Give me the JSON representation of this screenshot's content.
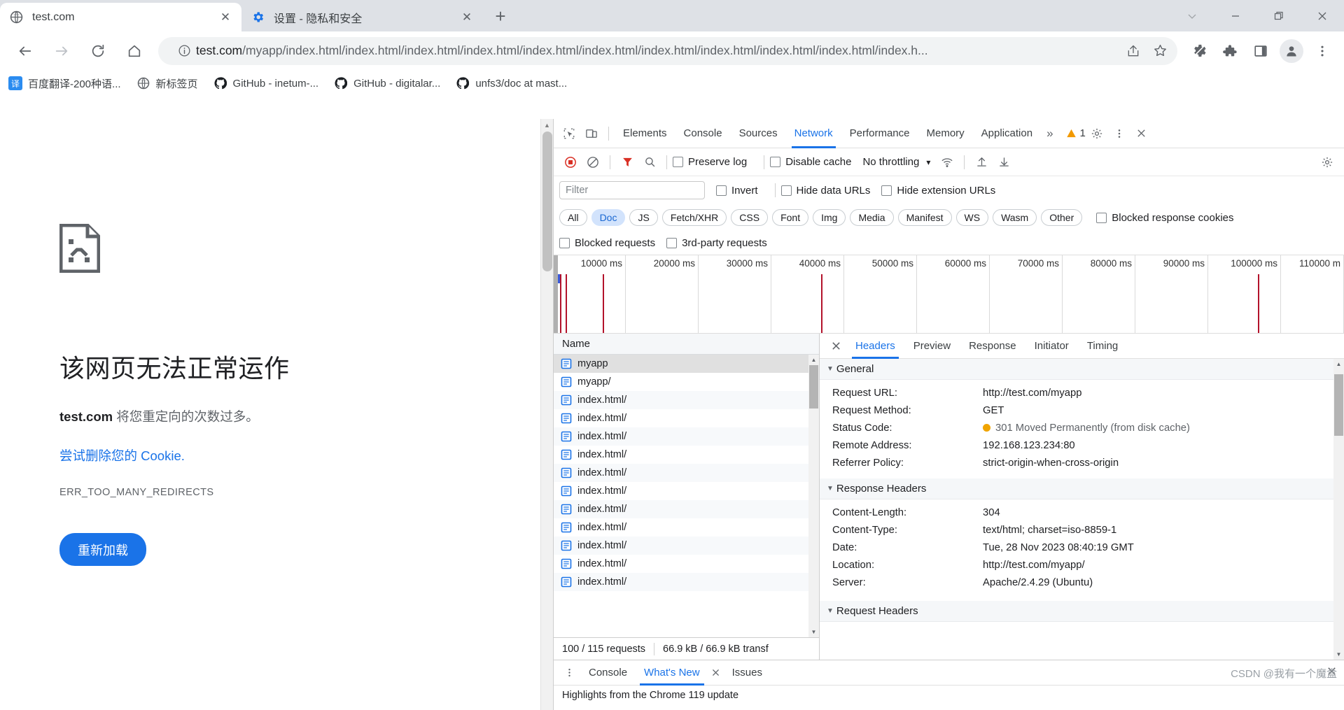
{
  "browser": {
    "tabs": [
      {
        "title": "test.com",
        "favicon": "globe-icon",
        "active": true
      },
      {
        "title": "设置 - 隐私和安全",
        "favicon": "gear-icon",
        "active": false
      }
    ],
    "new_tab_label": "+",
    "window_controls": [
      "chevron-down-icon",
      "minimize-icon",
      "restore-icon",
      "close-icon"
    ],
    "nav": {
      "back": "back-arrow-icon",
      "forward": "forward-arrow-icon",
      "reload": "reload-icon",
      "home": "home-icon"
    },
    "omnibox": {
      "info_icon": "info-circle-icon",
      "url_host": "test.com",
      "url_path": "/myapp/index.html/index.html/index.html/index.html/index.html/index.html/index.html/index.html/index.html/index.html/index.h...",
      "share_icon": "share-icon",
      "bookmark_icon": "star-icon"
    },
    "toolbar_icons": [
      "bug-gear-icon",
      "extensions-puzzle-icon",
      "side-panel-icon",
      "profile-avatar-icon",
      "menu-kebab-icon"
    ],
    "bookmarks": [
      {
        "label": "百度翻译-200种语...",
        "icon": "translate-badge-icon"
      },
      {
        "label": "新标签页",
        "icon": "globe-icon"
      },
      {
        "label": "GitHub - inetum-...",
        "icon": "github-icon"
      },
      {
        "label": "GitHub - digitalar...",
        "icon": "github-icon"
      },
      {
        "label": "unfs3/doc at mast...",
        "icon": "github-icon"
      }
    ]
  },
  "error_page": {
    "icon": "sad-page-icon",
    "title": "该网页无法正常运作",
    "subtitle_host": "test.com",
    "subtitle_rest": " 将您重定向的次数过多。",
    "link": "尝试删除您的 Cookie.",
    "code": "ERR_TOO_MANY_REDIRECTS",
    "reload_button": "重新加载"
  },
  "devtools": {
    "tabs": [
      {
        "label": "Elements",
        "selected": false
      },
      {
        "label": "Console",
        "selected": false
      },
      {
        "label": "Sources",
        "selected": false
      },
      {
        "label": "Network",
        "selected": true
      },
      {
        "label": "Performance",
        "selected": false
      },
      {
        "label": "Memory",
        "selected": false
      },
      {
        "label": "Application",
        "selected": false
      }
    ],
    "overflow_label": "»",
    "warning_count": "1",
    "inspect_icon": "inspect-cursor-icon",
    "device_icon": "device-toolbar-icon",
    "settings_icon": "gear-icon",
    "kebab_icon": "menu-kebab-icon",
    "close_icon": "close-icon",
    "toolbar": {
      "record_icon": "record-stop-icon",
      "clear_icon": "clear-circle-icon",
      "filter_icon": "funnel-icon",
      "search_icon": "search-icon",
      "preserve_log": "Preserve log",
      "disable_cache": "Disable cache",
      "throttling": "No throttling",
      "throttling_caret": "▾",
      "wifi_icon": "wifi-throttle-icon",
      "import_icon": "upload-har-icon",
      "export_icon": "download-har-icon"
    },
    "filters": {
      "placeholder": "Filter",
      "invert": "Invert",
      "hide_data_urls": "Hide data URLs",
      "hide_extension_urls": "Hide extension URLs",
      "types": [
        {
          "label": "All",
          "active": false
        },
        {
          "label": "Doc",
          "active": true
        },
        {
          "label": "JS",
          "active": false
        },
        {
          "label": "Fetch/XHR",
          "active": false
        },
        {
          "label": "CSS",
          "active": false
        },
        {
          "label": "Font",
          "active": false
        },
        {
          "label": "Img",
          "active": false
        },
        {
          "label": "Media",
          "active": false
        },
        {
          "label": "Manifest",
          "active": false
        },
        {
          "label": "WS",
          "active": false
        },
        {
          "label": "Wasm",
          "active": false
        },
        {
          "label": "Other",
          "active": false
        }
      ],
      "blocked_response_cookies": "Blocked response cookies",
      "blocked_requests": "Blocked requests",
      "third_party_requests": "3rd-party requests"
    },
    "overview": {
      "ticks": [
        "10000 ms",
        "20000 ms",
        "30000 ms",
        "40000 ms",
        "50000 ms",
        "60000 ms",
        "70000 ms",
        "80000 ms",
        "90000 ms",
        "100000 ms",
        "110000 m"
      ]
    },
    "request_list": {
      "column_header": "Name",
      "rows": [
        {
          "name": "myapp",
          "selected": true
        },
        {
          "name": "myapp/",
          "selected": false
        },
        {
          "name": "index.html/",
          "selected": false
        },
        {
          "name": "index.html/",
          "selected": false
        },
        {
          "name": "index.html/",
          "selected": false
        },
        {
          "name": "index.html/",
          "selected": false
        },
        {
          "name": "index.html/",
          "selected": false
        },
        {
          "name": "index.html/",
          "selected": false
        },
        {
          "name": "index.html/",
          "selected": false
        },
        {
          "name": "index.html/",
          "selected": false
        },
        {
          "name": "index.html/",
          "selected": false
        },
        {
          "name": "index.html/",
          "selected": false
        },
        {
          "name": "index.html/",
          "selected": false
        }
      ]
    },
    "status": {
      "requests": "100 / 115 requests",
      "transferred": "66.9 kB / 66.9 kB transf"
    },
    "detail": {
      "tabs": [
        {
          "label": "Headers",
          "selected": true
        },
        {
          "label": "Preview",
          "selected": false
        },
        {
          "label": "Response",
          "selected": false
        },
        {
          "label": "Initiator",
          "selected": false
        },
        {
          "label": "Timing",
          "selected": false
        }
      ],
      "sections": [
        {
          "title": "General",
          "rows": [
            {
              "key": "Request URL:",
              "value": "http://test.com/myapp",
              "status": false
            },
            {
              "key": "Request Method:",
              "value": "GET",
              "status": false
            },
            {
              "key": "Status Code:",
              "value": "301 Moved Permanently (from disk cache)",
              "status": true
            },
            {
              "key": "Remote Address:",
              "value": "192.168.123.234:80",
              "status": false
            },
            {
              "key": "Referrer Policy:",
              "value": "strict-origin-when-cross-origin",
              "status": false
            }
          ]
        },
        {
          "title": "Response Headers",
          "rows": [
            {
              "key": "Content-Length:",
              "value": "304",
              "status": false
            },
            {
              "key": "Content-Type:",
              "value": "text/html; charset=iso-8859-1",
              "status": false
            },
            {
              "key": "Date:",
              "value": "Tue, 28 Nov 2023 08:40:19 GMT",
              "status": false
            },
            {
              "key": "Location:",
              "value": "http://test.com/myapp/",
              "status": false
            },
            {
              "key": "Server:",
              "value": "Apache/2.4.29 (Ubuntu)",
              "status": false
            }
          ]
        },
        {
          "title": "Request Headers",
          "rows": []
        }
      ]
    },
    "drawer": {
      "kebab_icon": "menu-kebab-icon",
      "tabs": [
        {
          "label": "Console",
          "selected": false,
          "closable": false
        },
        {
          "label": "What's New",
          "selected": true,
          "closable": true
        },
        {
          "label": "Issues",
          "selected": false,
          "closable": false
        }
      ],
      "close_icon": "close-icon",
      "body_text": "Highlights from the Chrome 119 update"
    }
  },
  "watermark": "CSDN @我有一个魔盒",
  "colors": {
    "accent": "#1a73e8",
    "chrome_tabstrip": "#dee1e6",
    "status_orange": "#f0a400",
    "waterfall_red": "#b3122b",
    "button_blue": "#1a73e8"
  }
}
